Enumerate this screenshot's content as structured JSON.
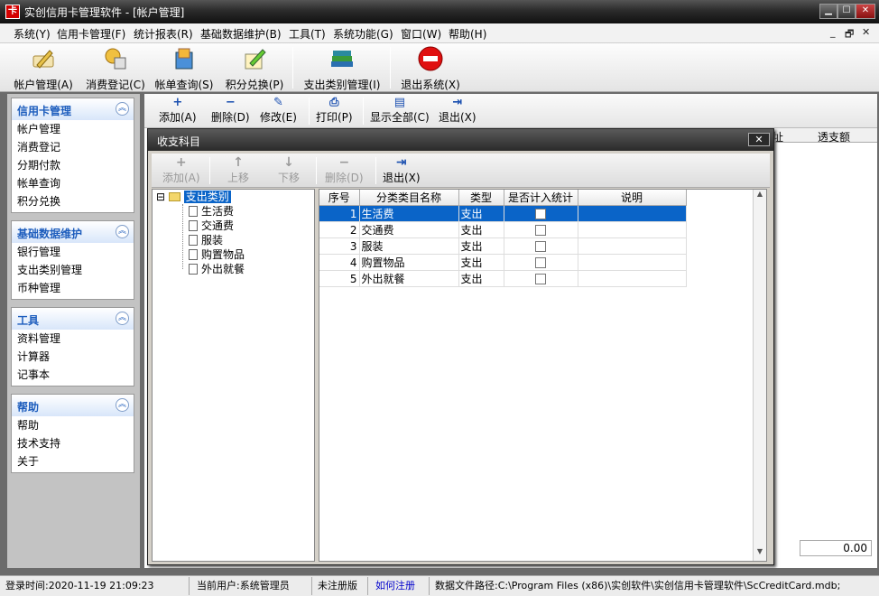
{
  "window": {
    "title": "实创信用卡管理软件 - [帐户管理]",
    "logo_text": "卡",
    "min": "▁",
    "max": "☐",
    "close": "✕"
  },
  "menu": [
    "系统(Y)",
    "信用卡管理(F)",
    "统计报表(R)",
    "基础数据维护(B)",
    "工具(T)",
    "系统功能(G)",
    "窗口(W)",
    "帮助(H)"
  ],
  "mdi_controls": [
    "_",
    "🗗",
    "✕"
  ],
  "main_toolbar": [
    {
      "label": "帐户管理(A)",
      "icon": "pen-card-icon"
    },
    {
      "label": "消费登记(C)",
      "icon": "shopping-icon"
    },
    {
      "label": "帐单查询(S)",
      "icon": "bill-icon"
    },
    {
      "label": "积分兑换(P)",
      "icon": "exchange-icon"
    },
    {
      "label": "支出类别管理(I)",
      "icon": "books-icon"
    },
    {
      "label": "退出系统(X)",
      "icon": "exit-icon"
    }
  ],
  "sidebar": [
    {
      "title": "信用卡管理",
      "items": [
        "帐户管理",
        "消费登记",
        "分期付款",
        "帐单查询",
        "积分兑换"
      ]
    },
    {
      "title": "基础数据维护",
      "items": [
        "银行管理",
        "支出类别管理",
        "币种管理"
      ]
    },
    {
      "title": "工具",
      "items": [
        "资料管理",
        "计算器",
        "记事本"
      ]
    },
    {
      "title": "帮助",
      "items": [
        "帮助",
        "技术支持",
        "关于"
      ]
    }
  ],
  "sub_toolbar": [
    {
      "label": "添加(A)",
      "icon": "+"
    },
    {
      "label": "删除(D)",
      "icon": "−"
    },
    {
      "label": "修改(E)",
      "icon": "✎"
    },
    {
      "label": "打印(P)",
      "icon": "⎙"
    },
    {
      "label": "显示全部(C)",
      "icon": "▤"
    },
    {
      "label": "退出(X)",
      "icon": "⇥"
    }
  ],
  "background_columns": [
    "址",
    "透支额"
  ],
  "background_total": "0.00",
  "dialog": {
    "title": "收支科目",
    "close": "✕",
    "toolbar": [
      {
        "label": "添加(A)",
        "icon": "+",
        "disabled": true
      },
      {
        "label": "上移",
        "icon": "↑",
        "disabled": true
      },
      {
        "label": "下移",
        "icon": "↓",
        "disabled": true
      },
      {
        "label": "删除(D)",
        "icon": "−",
        "disabled": true
      },
      {
        "label": "退出(X)",
        "icon": "⇥",
        "disabled": false
      }
    ],
    "tree": {
      "root": "支出类别",
      "expander": "⊟",
      "children": [
        "生活费",
        "交通费",
        "服装",
        "购置物品",
        "外出就餐"
      ]
    },
    "grid": {
      "columns": [
        "序号",
        "分类类目名称",
        "类型",
        "是否计入统计",
        "说明"
      ],
      "rows": [
        {
          "no": "1",
          "name": "生活费",
          "type": "支出",
          "counted": false,
          "note": ""
        },
        {
          "no": "2",
          "name": "交通费",
          "type": "支出",
          "counted": false,
          "note": ""
        },
        {
          "no": "3",
          "name": "服装",
          "type": "支出",
          "counted": false,
          "note": ""
        },
        {
          "no": "4",
          "name": "购置物品",
          "type": "支出",
          "counted": false,
          "note": ""
        },
        {
          "no": "5",
          "name": "外出就餐",
          "type": "支出",
          "counted": false,
          "note": ""
        }
      ],
      "selected_row": 0
    }
  },
  "status": {
    "login_time": "登录时间:2020-11-19 21:09:23",
    "current_user": "当前用户:系统管理员",
    "registration": "未注册版",
    "how_register": "如何注册",
    "db_path": "数据文件路径:C:\\Program Files (x86)\\实创软件\\实创信用卡管理软件\\ScCreditCard.mdb;"
  },
  "colors": {
    "selection": "#0a64c8",
    "link": "#0000cc",
    "sidebar_header": "#1d5dbd"
  }
}
